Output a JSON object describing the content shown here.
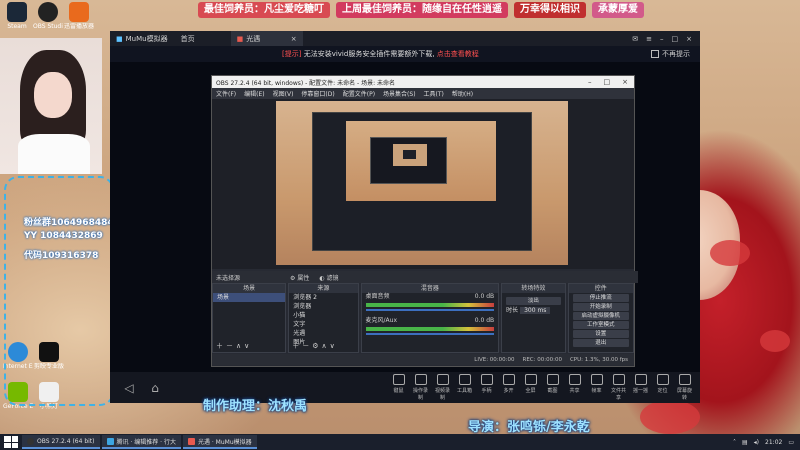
{
  "banner": {
    "item1": "最佳饲养员：凡尘爱吃糖叮",
    "item2": "上周最佳饲养员：随缘自在任性逍遥",
    "item3": "万幸得以相识",
    "item4": "承蒙厚爱"
  },
  "desktop_icons": [
    {
      "label": "Steam"
    },
    {
      "label": "OBS Studio"
    },
    {
      "label": "迅雷播放器"
    },
    {
      "label": "Internet Explorer"
    },
    {
      "label": "GeForce Experience"
    },
    {
      "label": "剪映专业版"
    },
    {
      "label": "小黑灯"
    }
  ],
  "chat_overlay": {
    "line1": "粉丝群1064968484",
    "line2": "YY 1084432869",
    "line3": "代码109316378"
  },
  "mumu": {
    "tab1": "MuMu模拟器",
    "tab1_sub": "首页",
    "tab2": "光遇",
    "notice_prefix": "[提示]",
    "notice_text": "无法安装vivid服务安全插件需要额外下载,",
    "notice_link": "点击查看教程",
    "notice_checkbox": "不再提示",
    "tools": [
      "键鼠",
      "操作录制",
      "视频录制",
      "工具箱",
      "手柄",
      "多开",
      "全屏",
      "截图",
      "共享",
      "帧率",
      "文件共享",
      "摇一摇",
      "定位",
      "屏幕旋转"
    ]
  },
  "obs": {
    "title": "OBS 27.2.4 (64 bit, windows) - 配置文件: 未命名 - 场景: 未命名",
    "menu": [
      "文件(F)",
      "编辑(E)",
      "视图(V)",
      "停靠窗口(D)",
      "配置文件(P)",
      "场景集合(S)",
      "工具(T)",
      "帮助(H)"
    ],
    "source_status": "未选择源",
    "prop_btn": "属性",
    "filter_btn": "滤镜",
    "docks": {
      "scenes": "场景",
      "sources": "来源",
      "mixer": "混音器",
      "transitions": "转场特效",
      "controls": "控件"
    },
    "scene_items": [
      "场景"
    ],
    "source_items": [
      "浏览器 2",
      "浏览器",
      "小猫",
      "文字",
      "光遇",
      "图片"
    ],
    "mixer_items": [
      {
        "name": "桌面音频",
        "db": "0.0 dB"
      },
      {
        "name": "麦克风/Aux",
        "db": "0.0 dB"
      }
    ],
    "transition_name": "淡出",
    "transition_duration_label": "时长",
    "transition_duration": "300 ms",
    "control_buttons": [
      "停止推流",
      "开始录制",
      "启动虚拟摄像机",
      "工作室模式",
      "设置",
      "退出"
    ],
    "footer": {
      "live": "LIVE: 00:00:00",
      "rec": "REC: 00:00:00",
      "cpu": "CPU: 1.3%, 30.00 fps"
    }
  },
  "subtitles": {
    "assistant": "制作助理：沈秋禹",
    "director": "导演：张鸣铄/李永乾"
  },
  "taskbar": {
    "items": [
      "OBS 27.2.4 (64 bit)",
      "腾讯 · 编辑推荐 · 行大",
      "光遇 · MuMu模拟器"
    ],
    "time": "21:02"
  }
}
